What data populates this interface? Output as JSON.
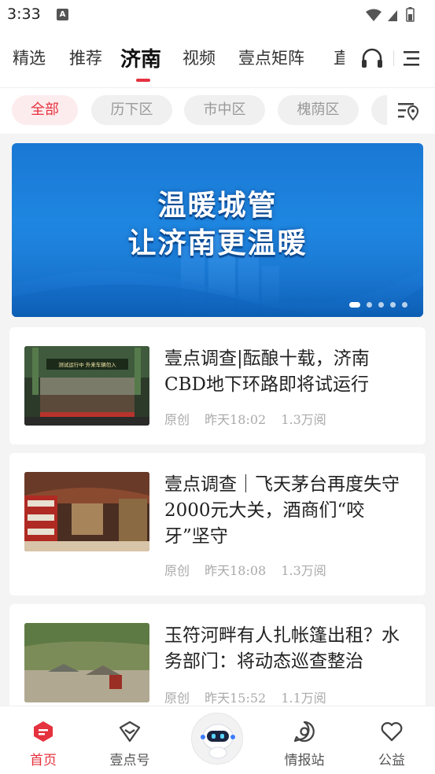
{
  "status_bar": {
    "time": "3:33",
    "notif_letter": "A"
  },
  "nav": {
    "tabs": [
      {
        "label": "精选"
      },
      {
        "label": "推荐"
      },
      {
        "label": "济南"
      },
      {
        "label": "视频"
      },
      {
        "label": "壹点矩阵"
      },
      {
        "label": "直"
      }
    ],
    "active_tab": "济南",
    "headphone_icon": "headphone-icon",
    "menu_icon": "menu-icon"
  },
  "district_chips": [
    {
      "label": "全部"
    },
    {
      "label": "历下区"
    },
    {
      "label": "市中区"
    },
    {
      "label": "槐荫区"
    }
  ],
  "banner": {
    "line1": "温暖城管",
    "line2": "让济南更温暖",
    "slides": 5,
    "active_slide": 1
  },
  "articles": [
    {
      "title": "壹点调查|酝酿十载，济南CBD地下环路即将试运行",
      "source": "原创",
      "time": "昨天18:02",
      "reads": "1.3万阅",
      "thumb_text": "测试运行中 外来车辆勿入"
    },
    {
      "title": "壹点调查｜飞天茅台再度失守2000元大关，酒商们“咬牙”坚守",
      "source": "原创",
      "time": "昨天18:08",
      "reads": "1.3万阅"
    },
    {
      "title": "玉符河畔有人扎帐篷出租？水务部门：将动态巡查整治",
      "source": "原创",
      "time": "昨天15:52",
      "reads": "1.1万阅"
    }
  ],
  "bottom_nav": [
    {
      "label": "首页",
      "icon": "home-icon"
    },
    {
      "label": "壹点号",
      "icon": "diamond-icon"
    },
    {
      "label": "",
      "icon": "robot-icon"
    },
    {
      "label": "情报站",
      "icon": "radar-icon"
    },
    {
      "label": "公益",
      "icon": "heart-icon"
    }
  ],
  "colors": {
    "accent": "#e5323f",
    "banner_blue": "#1a78d4"
  }
}
